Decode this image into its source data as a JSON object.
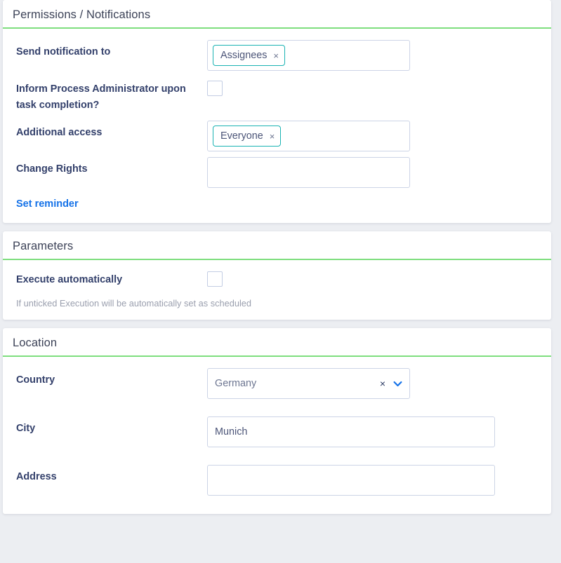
{
  "theme": {
    "accent_green": "#7ede7e",
    "chip_border_teal": "#1ab3b3",
    "link_blue": "#1572e8",
    "label_navy": "#33406b",
    "page_background": "#eceef2"
  },
  "sections": [
    {
      "id": "permissions-notifications",
      "title": "Permissions / Notifications",
      "fields": {
        "send_notification_to": {
          "label": "Send notification to",
          "chips": [
            {
              "label": "Assignees",
              "remove_icon": "close-icon",
              "remove_glyph": "×"
            }
          ]
        },
        "inform_process_admin": {
          "label": "Inform Process Administrator upon task completion?",
          "checked": false
        },
        "additional_access": {
          "label": "Additional access",
          "chips": [
            {
              "label": "Everyone",
              "remove_icon": "close-icon",
              "remove_glyph": "×"
            }
          ]
        },
        "change_rights": {
          "label": "Change Rights",
          "value": "",
          "placeholder": ""
        }
      },
      "links": {
        "set_reminder": "Set reminder"
      }
    },
    {
      "id": "parameters",
      "title": "Parameters",
      "fields": {
        "execute_automatically": {
          "label": "Execute automatically",
          "checked": false,
          "hint": "If unticked Execution will be automatically set as scheduled"
        }
      }
    },
    {
      "id": "location",
      "title": "Location",
      "fields": {
        "country": {
          "label": "Country",
          "value": "Germany",
          "clear_glyph": "×",
          "caret_icon": "chevron-down-icon"
        },
        "city": {
          "label": "City",
          "value": "Munich",
          "placeholder": ""
        },
        "address": {
          "label": "Address",
          "value": "",
          "placeholder": ""
        }
      }
    }
  ]
}
